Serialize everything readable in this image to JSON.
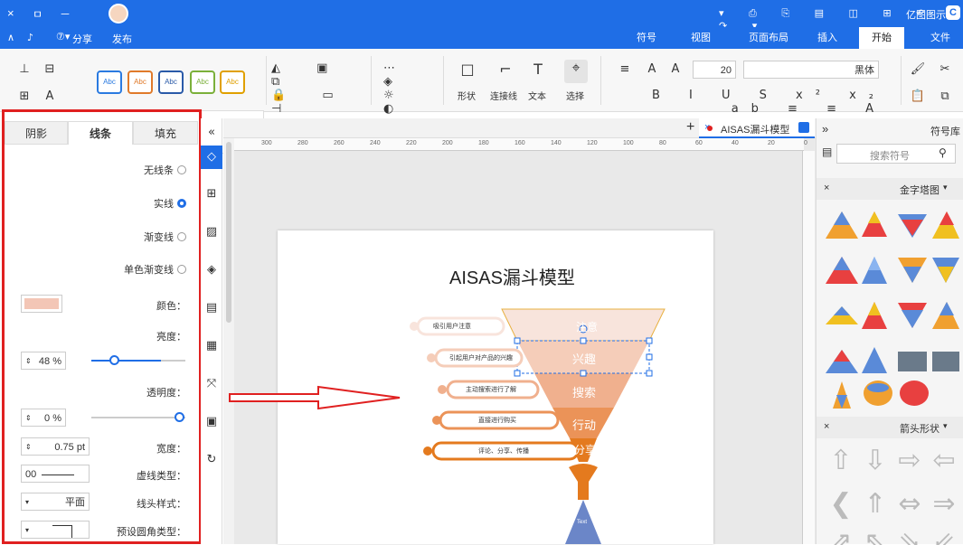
{
  "titlebar": {
    "app_name": "亿图图示",
    "close": "×",
    "minimize": "－",
    "restore": "ㅁ"
  },
  "menubar": {
    "tabs": [
      "文件",
      "开始",
      "插入",
      "页面布局",
      "视图",
      "符号"
    ],
    "active_tab": "开始",
    "left_actions": [
      "发布",
      "分享"
    ]
  },
  "toolbar": {
    "font_name": "黑体",
    "font_size": "20",
    "labels": {
      "select": "选择",
      "text": "文本",
      "connector": "连接线",
      "shape": "形状"
    },
    "style_boxes": [
      {
        "label": "Abc",
        "color": "#e0a000"
      },
      {
        "label": "Abc",
        "color": "#7bb03a"
      },
      {
        "label": "Abc",
        "color": "#2a5aa8"
      },
      {
        "label": "Abc",
        "color": "#e07a2a"
      },
      {
        "label": "Abc",
        "color": "#2a7ae0"
      }
    ]
  },
  "left_panel": {
    "tabs": [
      "填充",
      "线条",
      "阴影"
    ],
    "active_tab": "线条",
    "line_options": [
      {
        "label": "无线条",
        "selected": false
      },
      {
        "label": "实线",
        "selected": true
      },
      {
        "label": "渐变线",
        "selected": false
      },
      {
        "label": "单色渐变线",
        "selected": false
      }
    ],
    "color_label": "颜色：",
    "color_value": "#f3c6b6",
    "brightness_label": "亮度：",
    "brightness_value": "48 %",
    "brightness_fraction": 0.48,
    "transparency_label": "透明度：",
    "transparency_value": "0 %",
    "transparency_fraction": 0.0,
    "width_label": "宽度：",
    "width_value": "0.75 pt",
    "dash_label": "虚线类型：",
    "dash_value": "00",
    "arrow_label": "线头样式：",
    "arrow_value": "平面",
    "corner_label": "预设圆角类型："
  },
  "canvas": {
    "doc_tab": "AISAS漏斗模型",
    "ruler_ticks": [
      "300",
      "280",
      "260",
      "240",
      "220",
      "200",
      "180",
      "160",
      "140",
      "120",
      "100",
      "80",
      "60",
      "40",
      "20",
      "0"
    ],
    "diagram_title": "AISAS漏斗模型",
    "funnel_layers": [
      {
        "label": "注意",
        "color": "#f8e4dc"
      },
      {
        "label": "兴趣",
        "color": "#f5cdb9"
      },
      {
        "label": "搜索",
        "color": "#f0b08e"
      },
      {
        "label": "行动",
        "color": "#eb9358"
      },
      {
        "label": "分享",
        "color": "#e47a1e"
      }
    ],
    "callouts": [
      "吸引用户注意",
      "引起用户对产品的兴趣",
      "主动搜索进行了解",
      "直接进行购买",
      "评论、分享、传播"
    ],
    "bottom_shape_text": "Text"
  },
  "right_panel": {
    "header": "符号库",
    "search_placeholder": "搜索符号",
    "section1": "金字塔图",
    "section2": "箭头形状"
  },
  "colors": {
    "brand_blue": "#1f6ee6",
    "highlight_red": "#e02020",
    "funnel_accent": "#e47a1e"
  }
}
